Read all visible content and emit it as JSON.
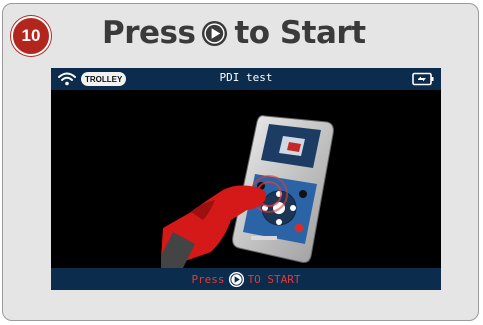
{
  "step": {
    "number": "10"
  },
  "header": {
    "title_before": "Press",
    "title_after": "to Start",
    "icon": "play-button-icon"
  },
  "screen": {
    "status_bar": {
      "wifi_icon": "wifi-icon",
      "badge": "TROLLEY",
      "title": "PDI test",
      "battery_icon": "battery-icon"
    },
    "illustration": "hand-pressing-tool-button",
    "bottom_bar": {
      "prompt_before": "Press",
      "prompt_after": "TO START",
      "icon": "play-button-icon"
    }
  },
  "colors": {
    "badge_red": "#b3261e",
    "title_gray": "#3a3a3a",
    "bar_navy": "#0b2c4c",
    "prompt_red": "#e53935"
  }
}
